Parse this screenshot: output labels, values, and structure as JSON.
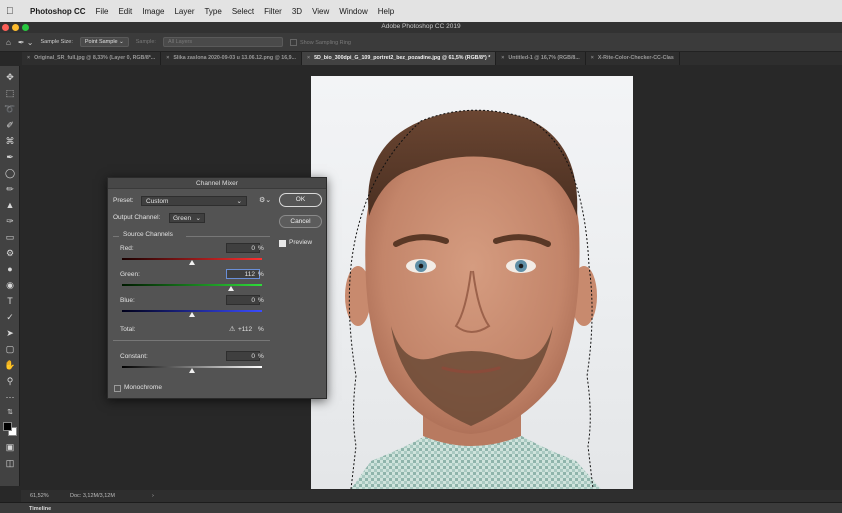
{
  "menubar": {
    "app_name": "Photoshop CC",
    "items": [
      "File",
      "Edit",
      "Image",
      "Layer",
      "Type",
      "Select",
      "Filter",
      "3D",
      "View",
      "Window",
      "Help"
    ]
  },
  "titlebar": {
    "title": "Adobe Photoshop CC 2019"
  },
  "options_bar": {
    "sample_size_label": "Sample Size:",
    "sample_size_value": "Point Sample",
    "sample_label": "Sample:",
    "sample_value": "All Layers",
    "show_sampling_ring": "Show Sampling Ring"
  },
  "tabs": [
    {
      "label": "Original_SR_full.jpg @ 8,33% (Layer 0, RGB/8*...",
      "active": false
    },
    {
      "label": "Slika zaslona 2020-09-03 u 13.06.12.png @ 16,9...",
      "active": false
    },
    {
      "label": "5D_bio_300dpi_G_109_portret2_bez_pozadine.jpg @ 61,5% (RGB/8*) *",
      "active": true
    },
    {
      "label": "Untitled-1 @ 16,7% (RGB/8...",
      "active": false
    },
    {
      "label": "X-Rite-Color-Checker-CC-Clas",
      "active": false
    }
  ],
  "status": {
    "zoom": "61,52%",
    "doc": "Doc: 3,12M/3,12M",
    "arrow": "›"
  },
  "timeline": {
    "label": "Timeline"
  },
  "channel_mixer": {
    "title": "Channel Mixer",
    "preset_label": "Preset:",
    "preset_value": "Custom",
    "ok_label": "OK",
    "cancel_label": "Cancel",
    "preview_label": "Preview",
    "preview_checked": true,
    "output_channel_label": "Output Channel:",
    "output_channel_value": "Green",
    "source_channels_label": "Source Channels",
    "percent": "%",
    "channels": [
      {
        "label": "Red:",
        "value": "0",
        "slider_fraction": 0.5
      },
      {
        "label": "Green:",
        "value": "112",
        "slider_fraction": 0.78
      },
      {
        "label": "Blue:",
        "value": "0",
        "slider_fraction": 0.5
      }
    ],
    "total_label": "Total:",
    "total_value": "+112",
    "constant_label": "Constant:",
    "constant_value": "0",
    "constant_slider_fraction": 0.5,
    "monochrome_label": "Monochrome",
    "monochrome_checked": false
  },
  "colors": {
    "canvas_bg": "#282828",
    "panel_bg": "#535353",
    "red_gradient_end": "#ff3030",
    "green_gradient_end": "#2fdc3a",
    "blue_gradient_end": "#3a4cff"
  }
}
